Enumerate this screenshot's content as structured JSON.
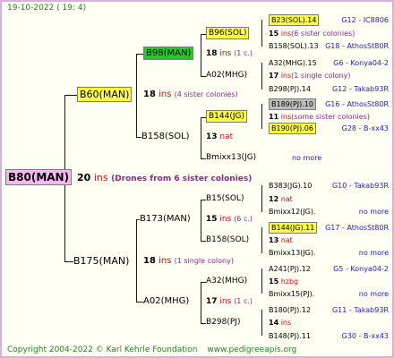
{
  "header": {
    "date": "19-10-2022",
    "time": "( 19: 4)"
  },
  "root": {
    "name": "B80(MAN)",
    "year": "20",
    "ins_label": "ins",
    "note": "(Drones from 6 sister colonies)"
  },
  "gen1": [
    {
      "name": "B60(MAN)",
      "year": "18",
      "ins_label": "ins",
      "note": "(4 sister colonies)"
    },
    {
      "name": "B175(MAN)",
      "year": "18",
      "ins_label": "ins",
      "note": "(1 single colony)"
    }
  ],
  "gen2": [
    {
      "name": "B98(MAN)",
      "year": "18",
      "ins_label": "ins",
      "note": "(1 c.)"
    },
    {
      "name": "B158(SOL)",
      "year": "13",
      "ins_label": "nat",
      "note": ""
    },
    {
      "name": "B173(MAN)",
      "year": "15",
      "ins_label": "ins",
      "note": "(6 c.)"
    },
    {
      "name": "A02(MHG)",
      "year": "17",
      "ins_label": "ins",
      "note": "(1 c.)"
    }
  ],
  "gen3": [
    {
      "name": "B96(SOL)",
      "year": "15",
      "ins_label": "ins",
      "note": "(6 sister colonies)"
    },
    {
      "name": "A02(MHG)",
      "year": "17",
      "ins_label": "ins",
      "note": "(1 single colony)"
    },
    {
      "name": "B144(JG)",
      "year": "11",
      "ins_label": "ins",
      "note": "(some sister colonies)"
    },
    {
      "name": "Bmixx13(JG)",
      "year": "",
      "ins_label": "",
      "note": "no more"
    },
    {
      "name": "B15(SOL)",
      "year": "12",
      "ins_label": "nat",
      "note": ""
    },
    {
      "name": "B158(SOL)",
      "year": "13",
      "ins_label": "nat",
      "note": ""
    },
    {
      "name": "A32(MHG)",
      "year": "15",
      "ins_label": "hzbg",
      "note": ""
    },
    {
      "name": "B298(PJ)",
      "year": "14",
      "ins_label": "ins",
      "note": ""
    }
  ],
  "gen4": [
    {
      "name": "B23(SOL).14",
      "tag": "G12 - IC8806"
    },
    {
      "name": "B158(SOL).13",
      "tag": "G18 - AthosSt80R"
    },
    {
      "name": "A32(MHG).15",
      "tag": "G6 - Konya04-2"
    },
    {
      "name": "B298(PJ).14",
      "tag": "G12 - Takab93R"
    },
    {
      "name": "B189(PJ).10",
      "tag": "G16 - AthosSt80R"
    },
    {
      "name": "B190(PJ).06",
      "tag": "G28 - B-xx43"
    },
    {
      "name": "",
      "tag": ""
    },
    {
      "name": "",
      "tag": ""
    },
    {
      "name": "B383(JG).10",
      "tag": "G10 - Takab93R"
    },
    {
      "name": "Bmixx12(JG).",
      "tag": "no more"
    },
    {
      "name": "B144(JG).11",
      "tag": "G17 - AthosSt80R"
    },
    {
      "name": "Bmixx13(JG).",
      "tag": "no more"
    },
    {
      "name": "A241(PJ).12",
      "tag": "G5 - Konya04-2"
    },
    {
      "name": "Bmixx15(PJ).",
      "tag": "no more"
    },
    {
      "name": "B180(PJ).12",
      "tag": "G11 - Takab93R"
    },
    {
      "name": "B148(PJ).11",
      "tag": "G30 - B-xx43"
    }
  ],
  "footer": {
    "copyright": "Copyright 2004-2022 © Karl Kehrle Foundation",
    "site": "www.pedigreeapis.org"
  },
  "colors": {
    "border": "#d6b3d6",
    "green_text": "#2a7d2a",
    "blue_text": "#2020d0",
    "red_text": "#d01010",
    "purple_text": "#8a2a8a",
    "highlight_yellow": "#ffff40",
    "highlight_green": "#22cc22"
  }
}
